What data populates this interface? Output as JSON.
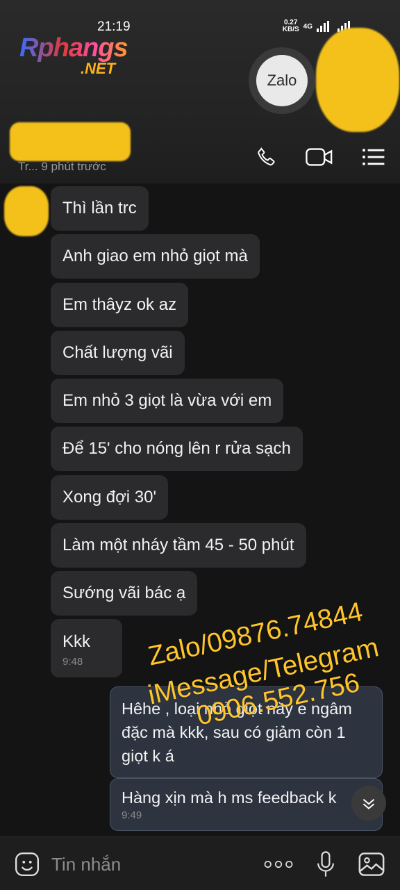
{
  "status_bar": {
    "time": "21:19",
    "net_speed_value": "0.27",
    "net_speed_unit": "KB/S",
    "network": "4G"
  },
  "watermark_logo": {
    "main": "Rphangs",
    "sub": ".NET"
  },
  "header": {
    "avatar_label": "Zalo",
    "last_seen": "Tr... 9 phút trước",
    "icons": [
      "phone-icon",
      "video-call-icon",
      "menu-icon"
    ]
  },
  "messages_in": [
    {
      "text": "Thì lần trc"
    },
    {
      "text": "Anh giao em nhỏ giọt mà"
    },
    {
      "text": "Em thâyz ok az"
    },
    {
      "text": "Chất lượng vãi"
    },
    {
      "text": "Em nhỏ 3 giọt là vừa với em"
    },
    {
      "text": "Để 15' cho nóng lên r rửa sạch"
    },
    {
      "text": "Xong đợi 30'"
    },
    {
      "text": "Làm một nháy tầm 45 - 50 phút"
    },
    {
      "text": "Sướng vãi bác ạ"
    },
    {
      "text": "Kkk",
      "time": "9:48"
    }
  ],
  "messages_out": [
    {
      "text": "Hêhe , loại nhỏ giọt này e ngâm đặc mà kkk, sau có giảm còn 1 giọt k á"
    },
    {
      "text": "Hàng xịn mà h ms feedback k",
      "time": "9:49"
    }
  ],
  "overlay_text": {
    "line1": "Zalo/09876.74844",
    "line2": "iMessage/Telegram",
    "line3": "0906.552.756"
  },
  "composer": {
    "placeholder": "Tin nhắn"
  },
  "colors": {
    "incoming_bubble": "#2b2b2d",
    "outgoing_bubble": "#2d3440",
    "watermark": "#ffc52a"
  }
}
